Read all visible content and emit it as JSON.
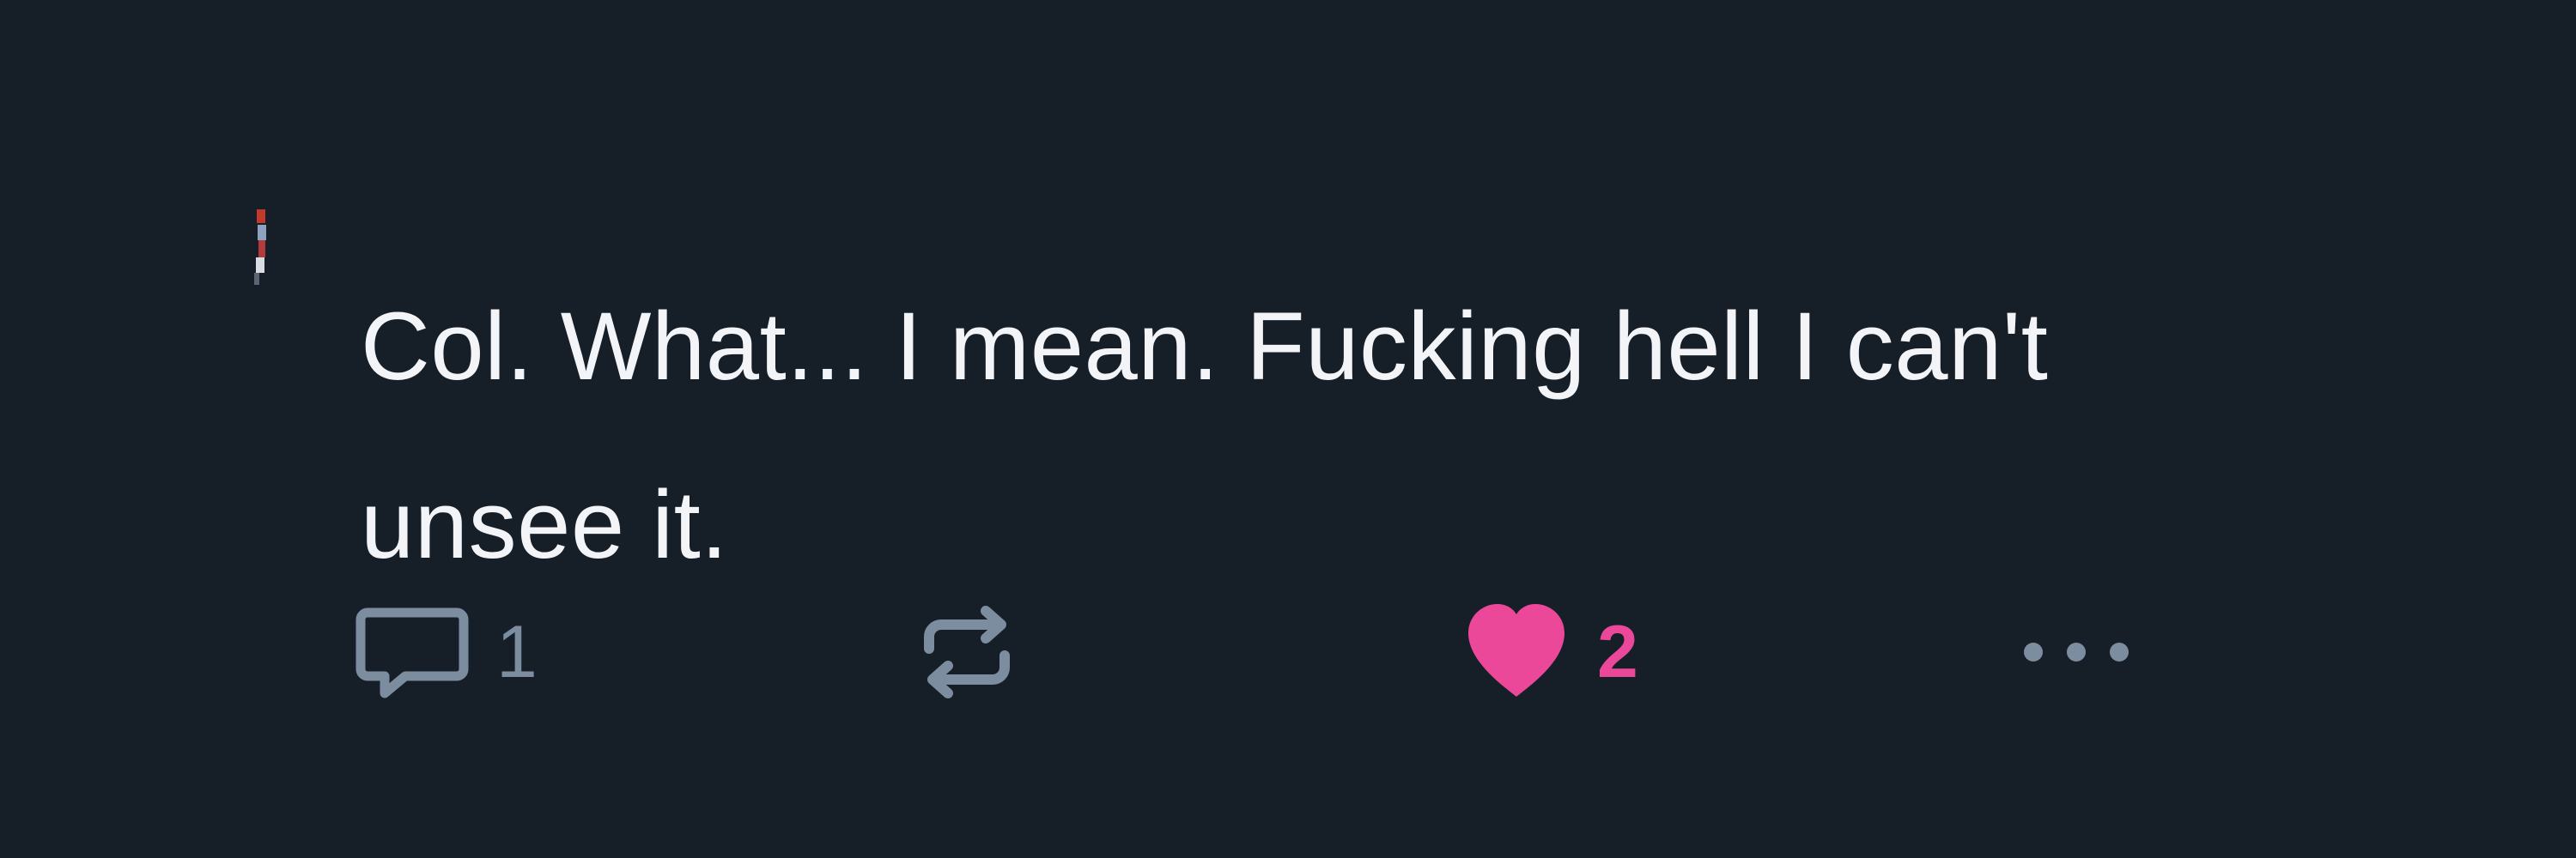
{
  "post": {
    "text_lines": [
      "Col. What... I mean. Fucking hell I can't",
      "unsee it."
    ],
    "actions": {
      "reply_count": "1",
      "like_count": "2",
      "liked": true
    }
  },
  "colors": {
    "background": "#161e28",
    "text": "#f2f4f7",
    "muted": "#7d8da0",
    "like_accent": "#ec4899"
  },
  "icons": {
    "reply": "reply-icon",
    "repost": "repost-icon",
    "like": "heart-icon",
    "more": "more-icon"
  }
}
